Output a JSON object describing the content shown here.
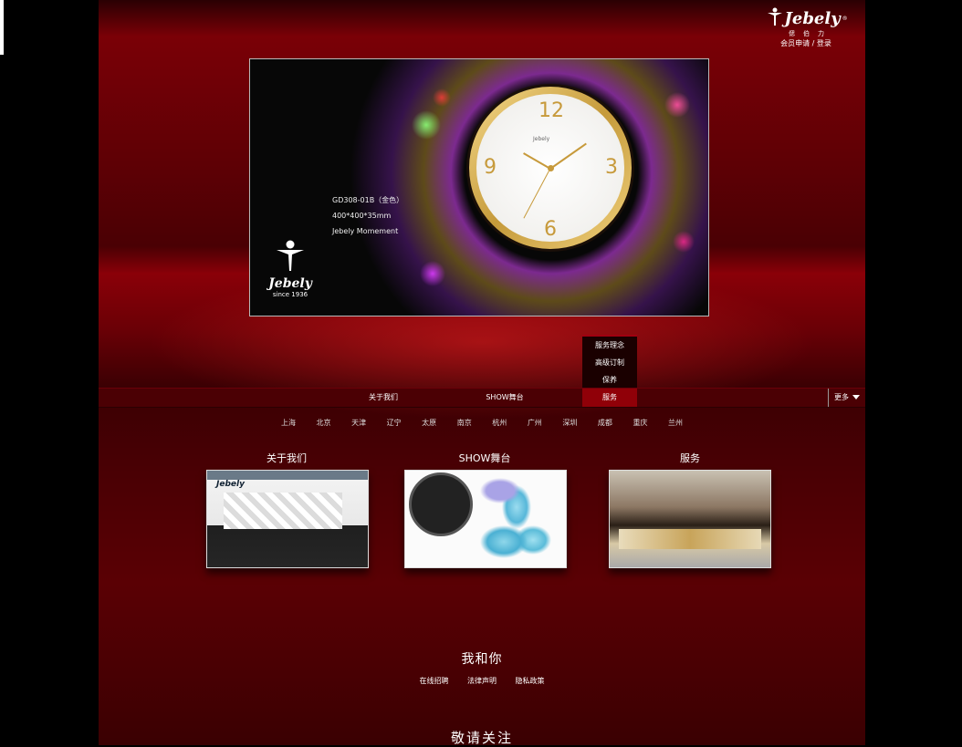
{
  "logo": {
    "wordmark": "Jebely",
    "reg": "®",
    "chinese": "偲伯力",
    "figure_icon": "person-figure-icon"
  },
  "member": {
    "register": "会员申请",
    "separator": " / ",
    "login": "登录"
  },
  "banner": {
    "product_model": "GD308-01B（金色）",
    "product_size": "400*400*35mm",
    "product_line": "Jebely Momement",
    "clock_numbers": [
      "12",
      "3",
      "6",
      "9"
    ],
    "clock_brand": "Jebely",
    "logo_word": "Jebely",
    "logo_since": "since 1936"
  },
  "nav": {
    "items": [
      "关于我们",
      "SHOW舞台",
      "服务"
    ],
    "more": "更多",
    "dropdown": [
      "服务理念",
      "高级订制",
      "保养"
    ]
  },
  "cities": [
    "上海",
    "北京",
    "天津",
    "辽宁",
    "太原",
    "南京",
    "杭州",
    "广州",
    "深圳",
    "成都",
    "重庆",
    "兰州"
  ],
  "sections": [
    {
      "title": "关于我们",
      "image_sign": "Jebely"
    },
    {
      "title": "SHOW舞台"
    },
    {
      "title": "服务"
    }
  ],
  "footer": {
    "heading": "我和你",
    "links": [
      "在线招聘",
      "法律声明",
      "隐私政策"
    ],
    "follow": "敬请关注"
  },
  "colors": {
    "primary_red": "#900008",
    "background": "#000000",
    "gold": "#c79a3b"
  }
}
